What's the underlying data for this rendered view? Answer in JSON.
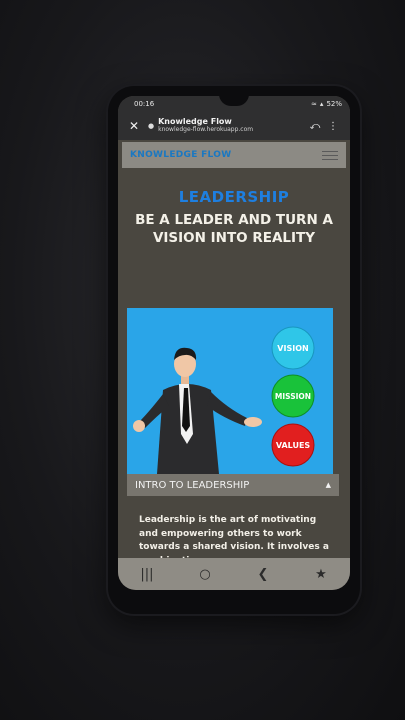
{
  "status_bar": {
    "time": "00:16",
    "battery": "52%"
  },
  "browser": {
    "close_icon": "close-icon",
    "title": "Knowledge Flow",
    "url": "knowledge-flow.herokuapp.com",
    "share_icon": "share-icon",
    "menu_icon": "more-vert-icon"
  },
  "site": {
    "brand": "KNOWLEDGE FLOW",
    "kicker": "LEADERSHIP",
    "title": "BE A LEADER AND TURN A VISION INTO REALITY",
    "badges": [
      "VISION",
      "MISSION",
      "VALUES"
    ],
    "accordion_label": "INTRO TO LEADERSHIP",
    "intro": "Leadership is the art of motivating and empowering others to work towards a shared vision. It involves a combination"
  },
  "colors": {
    "brand": "#1a78c2",
    "kicker": "#1e7fe0",
    "illustration_bg": "#2aa5e8",
    "vision": "#2fc6e8",
    "mission": "#19c23a",
    "values": "#e11f1f"
  }
}
